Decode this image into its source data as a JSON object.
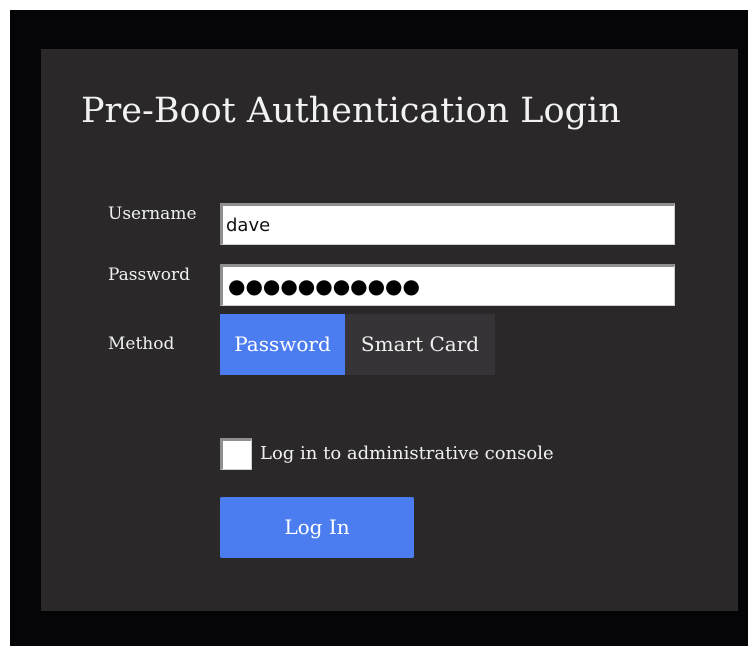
{
  "title": "Pre-Boot Authentication Login",
  "form": {
    "username_label": "Username",
    "username_value": "dave",
    "password_label": "Password",
    "password_masked": "●●●●●●●●●●●",
    "method_label": "Method",
    "methods": [
      {
        "label": "Password",
        "selected": true
      },
      {
        "label": "Smart Card",
        "selected": false
      }
    ],
    "admin_console_label": "Log in to administrative console",
    "admin_console_checked": false,
    "login_button_label": "Log In"
  },
  "colors": {
    "screen_bg": "#050507",
    "panel_bg": "#2a2829",
    "accent": "#4c7df0",
    "segment_inactive": "#363436",
    "text": "#f0f0f0"
  }
}
